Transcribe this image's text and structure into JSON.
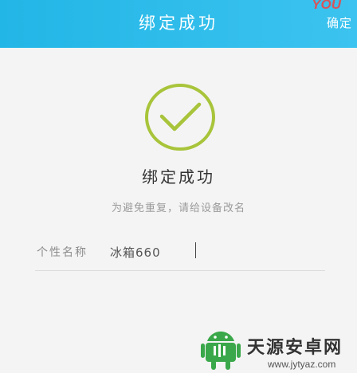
{
  "header": {
    "title": "绑定成功",
    "confirm_label": "确定",
    "watermark_text": "YOU",
    "background": "#2bbbe9"
  },
  "status": {
    "icon": "check-circle-icon",
    "icon_color": "#a8c43a",
    "title": "绑定成功",
    "hint": "为避免重复，请给设备改名"
  },
  "form": {
    "name_label": "个性名称",
    "name_value": "冰箱660"
  },
  "brand": {
    "logo_color": "#3aa84a",
    "name": "天源安卓网",
    "url": "www.jytyaz.com"
  }
}
